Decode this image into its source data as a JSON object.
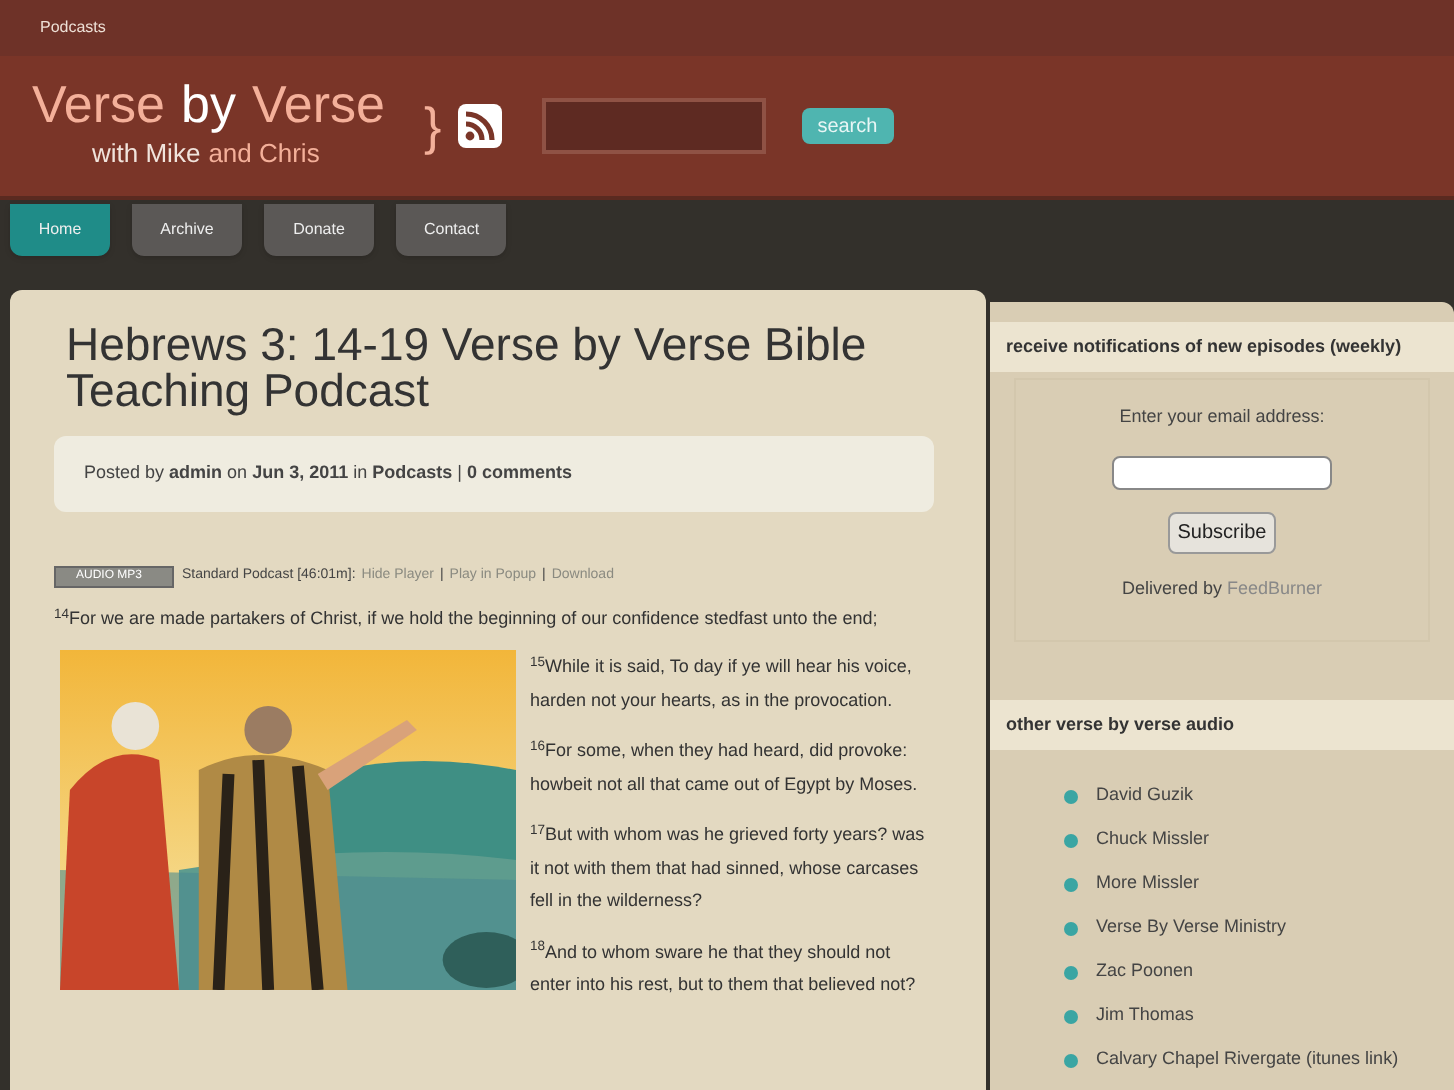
{
  "top_bar": {
    "links": [
      "Podcasts"
    ]
  },
  "header": {
    "title": [
      {
        "text": "Verse",
        "accent": true
      },
      {
        "text": "by",
        "accent": false
      },
      {
        "text": "Verse",
        "accent": true
      }
    ],
    "subtitle": [
      {
        "text": "with Mike",
        "accent": false
      },
      {
        "text": "and Chris",
        "accent": true
      }
    ],
    "brace": "}",
    "search_button": "search"
  },
  "nav": [
    {
      "label": "Home",
      "selected": true
    },
    {
      "label": "Archive",
      "selected": false
    },
    {
      "label": "Donate",
      "selected": false
    },
    {
      "label": "Contact",
      "selected": false
    }
  ],
  "post": {
    "title": "Hebrews 3: 14-19 Verse by Verse Bible Teaching Podcast",
    "meta": "Posted by **admin** on **Jun 3, 2011** in **Podcasts** | **0 comments**",
    "audio": {
      "badge": "AUDIO MP3",
      "label": "Standard Podcast [46:01m]:",
      "separator": "|",
      "links": [
        "Hide Player",
        "Play in Popup",
        "Download"
      ]
    },
    "intro": "$^{14}$For we are made partakers of Christ, if we hold the beginning of our confidence stedfast unto the end;",
    "verses": [
      "$^{15}$While it is said, To day if ye will hear his voice, harden not your hearts, as in the provocation.",
      "$^{16}$For some, when they had heard, did provoke: howbeit not all that came out of Egypt by Moses.",
      "$^{17}$But with whom was he grieved forty years? was it not with them that had sinned, whose carcases fell in the wilderness?",
      "$^{18}$And to whom sware he that they should not enter into his rest, but to them that believed not?"
    ]
  },
  "sidebar": {
    "subscribe": {
      "heading": "receive notifications of new episodes (weekly)",
      "prompt": "Enter your email address:",
      "button": "Subscribe",
      "delivered": "Delivered by",
      "feed_link": "FeedBurner"
    },
    "audio_links": {
      "heading": "other verse by verse audio",
      "items": [
        "David Guzik",
        "Chuck Missler",
        "More Missler",
        "Verse By Verse Ministry",
        "Zac Poonen",
        "Jim Thomas",
        "Calvary Chapel Rivergate (itunes link)"
      ]
    }
  }
}
